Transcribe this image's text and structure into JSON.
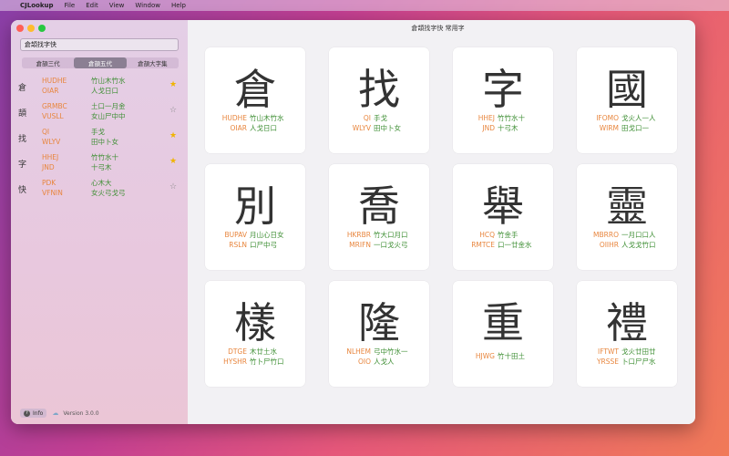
{
  "menubar": {
    "app": "CJLookup",
    "menus": [
      "File",
      "Edit",
      "View",
      "Window",
      "Help"
    ]
  },
  "window": {
    "title": "倉頡找字快 常用字"
  },
  "sidebar": {
    "search_value": "倉頡找字快",
    "segments": [
      {
        "label": "倉頡三代",
        "active": false
      },
      {
        "label": "倉頡五代",
        "active": true
      },
      {
        "label": "倉頡大字集",
        "active": false
      }
    ],
    "items": [
      {
        "char": "倉",
        "code1": "HUDHE",
        "root1": "竹山木竹水",
        "code2": "OIAR",
        "root2": "人戈日口",
        "starred": true
      },
      {
        "char": "頡",
        "code1": "GRMBC",
        "root1": "土口一月金",
        "code2": "VUSLL",
        "root2": "女山尸中中",
        "starred": false
      },
      {
        "char": "找",
        "code1": "QI",
        "root1": "手戈",
        "code2": "WLYV",
        "root2": "田中卜女",
        "starred": true
      },
      {
        "char": "字",
        "code1": "HHEJ",
        "root1": "竹竹水十",
        "code2": "JND",
        "root2": "十弓木",
        "starred": true
      },
      {
        "char": "快",
        "code1": "PDK",
        "root1": "心木大",
        "code2": "VFNIN",
        "root2": "女火弓戈弓",
        "starred": false
      }
    ],
    "footer": {
      "info_label": "Info",
      "version": "Version 3.0.0"
    }
  },
  "cards": [
    {
      "char": "倉",
      "rows": [
        {
          "code": "HUDHE",
          "root": "竹山木竹水"
        },
        {
          "code": "OIAR",
          "root": "人戈日口"
        }
      ]
    },
    {
      "char": "找",
      "rows": [
        {
          "code": "QI",
          "root": "手戈"
        },
        {
          "code": "WLYV",
          "root": "田中卜女"
        }
      ]
    },
    {
      "char": "字",
      "rows": [
        {
          "code": "HHEJ",
          "root": "竹竹水十"
        },
        {
          "code": "JND",
          "root": "十弓木"
        }
      ]
    },
    {
      "char": "國",
      "rows": [
        {
          "code": "IFOMO",
          "root": "戈火人一人"
        },
        {
          "code": "WIRM",
          "root": "田戈口一"
        }
      ]
    },
    {
      "char": "別",
      "rows": [
        {
          "code": "BUPAV",
          "root": "月山心日女"
        },
        {
          "code": "RSLN",
          "root": "口尸中弓"
        }
      ]
    },
    {
      "char": "喬",
      "rows": [
        {
          "code": "HKRBR",
          "root": "竹大口月口"
        },
        {
          "code": "MRIFN",
          "root": "一口戈火弓"
        }
      ]
    },
    {
      "char": "舉",
      "rows": [
        {
          "code": "HCQ",
          "root": "竹金手"
        },
        {
          "code": "RMTCE",
          "root": "口一廿金水"
        }
      ]
    },
    {
      "char": "靈",
      "rows": [
        {
          "code": "MBRRO",
          "root": "一月口口人"
        },
        {
          "code": "OIIHR",
          "root": "人戈戈竹口"
        }
      ]
    },
    {
      "char": "樣",
      "rows": [
        {
          "code": "DTGE",
          "root": "木廿土水"
        },
        {
          "code": "HYSHR",
          "root": "竹卜尸竹口"
        }
      ]
    },
    {
      "char": "隆",
      "rows": [
        {
          "code": "NLHEM",
          "root": "弓中竹水一"
        },
        {
          "code": "OIO",
          "root": "人戈人"
        }
      ]
    },
    {
      "char": "重",
      "rows": [
        {
          "code": "HJWG",
          "root": "竹十田土"
        }
      ]
    },
    {
      "char": "禮",
      "rows": [
        {
          "code": "IFTWT",
          "root": "戈火廿田廿"
        },
        {
          "code": "YRSSE",
          "root": "卜口尸尸水"
        }
      ]
    }
  ]
}
